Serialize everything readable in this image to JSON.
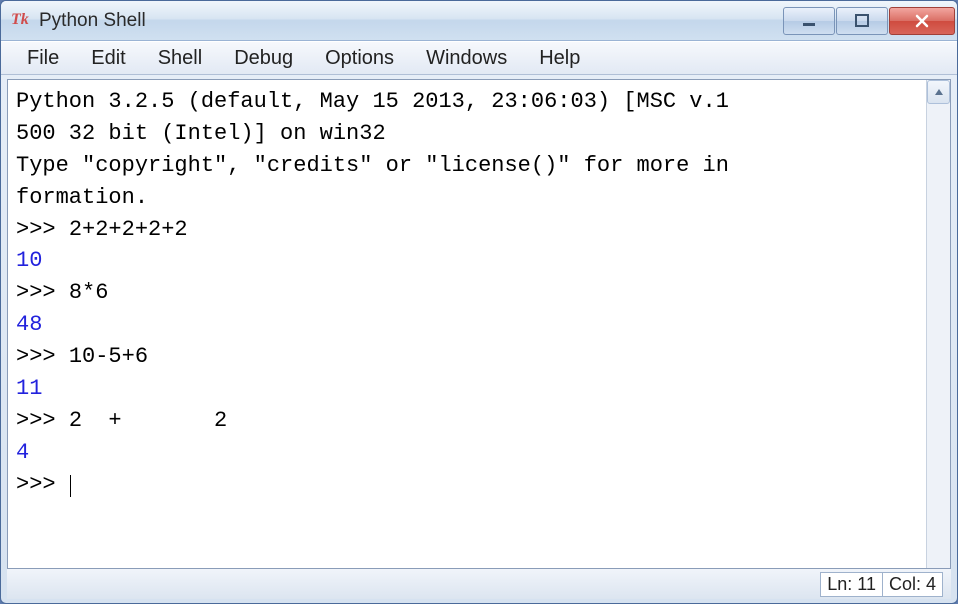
{
  "window": {
    "title": "Python Shell",
    "icon_label": "Tk"
  },
  "menu": {
    "items": [
      "File",
      "Edit",
      "Shell",
      "Debug",
      "Options",
      "Windows",
      "Help"
    ]
  },
  "shell": {
    "banner_line1": "Python 3.2.5 (default, May 15 2013, 23:06:03) [MSC v.1",
    "banner_line2": "500 32 bit (Intel)] on win32",
    "banner_line3": "Type \"copyright\", \"credits\" or \"license()\" for more in",
    "banner_line4": "formation.",
    "prompt": ">>> ",
    "entries": [
      {
        "in": "2+2+2+2+2",
        "out": "10"
      },
      {
        "in": "8*6",
        "out": "48"
      },
      {
        "in": "10-5+6",
        "out": "11"
      },
      {
        "in": "2  +       2",
        "out": "4"
      }
    ]
  },
  "status": {
    "line_label": "Ln: ",
    "line_value": "11",
    "col_label": "Col: ",
    "col_value": "4"
  }
}
